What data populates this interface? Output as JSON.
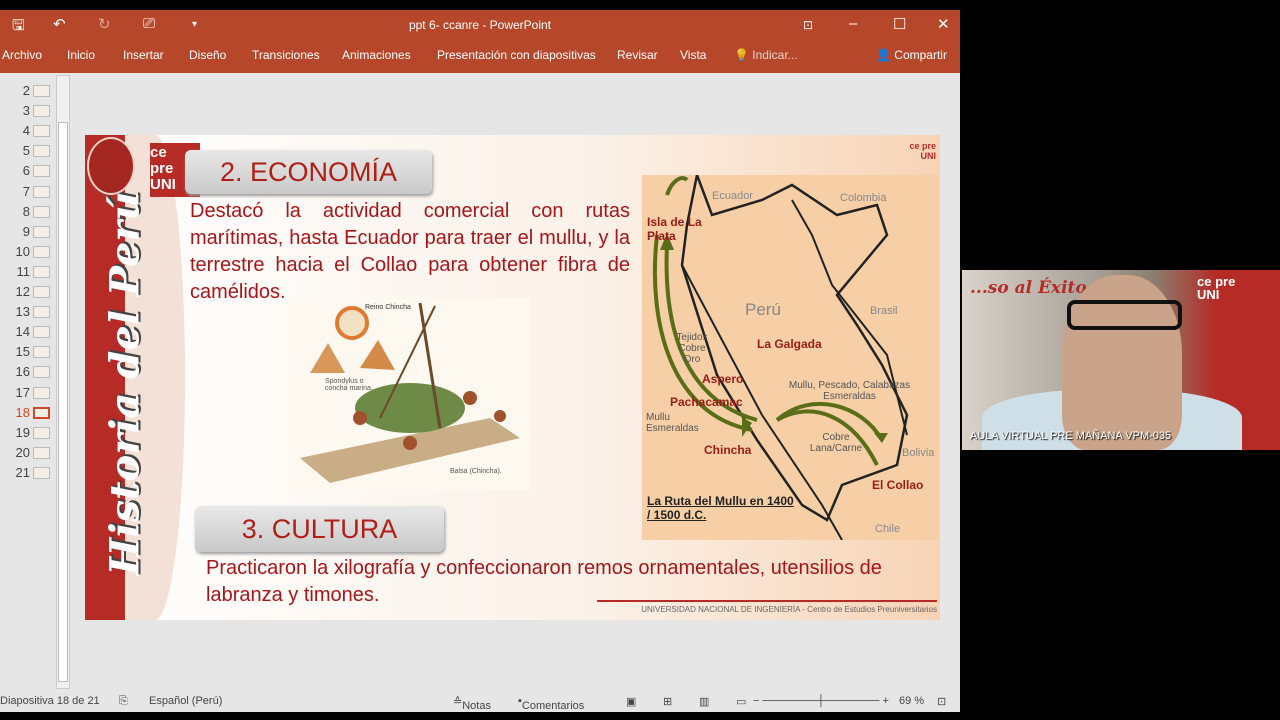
{
  "window": {
    "title": "ppt 6- ccanre - PowerPoint"
  },
  "ribbon": {
    "tabs": [
      "Archivo",
      "Inicio",
      "Insertar",
      "Diseño",
      "Transiciones",
      "Animaciones",
      "Presentación con diapositivas",
      "Revisar",
      "Vista"
    ],
    "tell_me": "Indicar...",
    "share": "Compartir"
  },
  "thumbnails": [
    "2",
    "3",
    "4",
    "5",
    "6",
    "7",
    "8",
    "9",
    "10",
    "11",
    "12",
    "13",
    "14",
    "15",
    "16",
    "17",
    "18",
    "19",
    "20",
    "21"
  ],
  "active_slide": "18",
  "slide": {
    "side_title": "Historia del Perú",
    "logo_text": "ce pre UNI",
    "section2_title": "2. ECONOMÍA",
    "section2_text": "Destacó la actividad comercial con rutas marítimas, hasta Ecuador para traer el mullu, y la terrestre hacia el Collao para obtener fibra de camélidos.",
    "image_labels": {
      "top": "Reino Chincha",
      "shell": "Spondylus o concha marina.",
      "raft": "Balsa (Chincha)."
    },
    "map": {
      "countries": [
        "Ecuador",
        "Colombia",
        "Perú",
        "Brasil",
        "Bolivia",
        "Chile"
      ],
      "places": [
        "Isla de La Plata",
        "La Galgada",
        "Aspero",
        "Pachacamac",
        "Chincha",
        "El Collao"
      ],
      "goods": [
        "Tejidos Cobre Oro",
        "Mullu Esmeraldas",
        "Mullu, Pescado, Calabazas Esmeraldas",
        "Cobre Lana/Carne"
      ],
      "caption": "La Ruta del Mullu en 1400 / 1500 d.C."
    },
    "section3_title": "3. CULTURA",
    "section3_text": "Practicaron la xilografía y confeccionaron remos ornamentales, utensilios de labranza y timones.",
    "footer": "UNIVERSIDAD NACIONAL DE INGENIERÍA - Centro de Estudios Preuniversitarios"
  },
  "status": {
    "slide": "Diapositiva 18 de 21",
    "language": "Español (Perú)",
    "notes": "Notas",
    "comments": "Comentarios",
    "zoom": "69 %"
  },
  "webcam": {
    "caption": "AULA VIRTUAL PRE MAÑANA VPM-035",
    "banner": "...so al Éxito",
    "logo": "ce pre UNI"
  }
}
